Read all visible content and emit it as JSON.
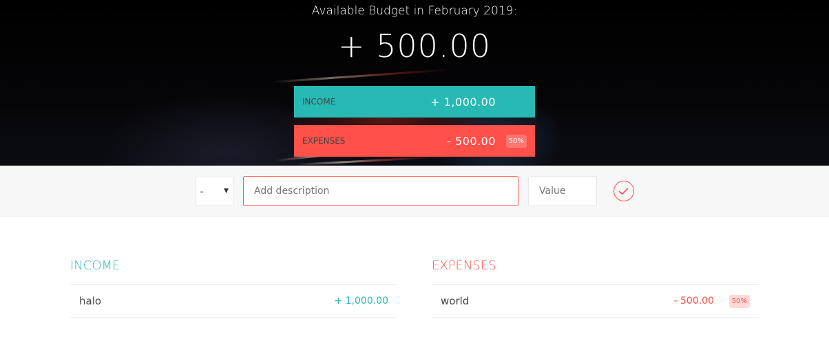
{
  "header": {
    "budget_title": "Available Budget in February 2019:",
    "budget_value": "+ 500.00",
    "income": {
      "label": "Income",
      "value": "+ 1,000.00"
    },
    "expenses": {
      "label": "Expenses",
      "value": "- 500.00",
      "percentage": "50%"
    }
  },
  "add_form": {
    "type_selected": "-",
    "description_placeholder": "Add description",
    "description_value": "",
    "value_placeholder": "Value",
    "value_value": "",
    "submit_icon": "checkmark-circle-icon"
  },
  "income_list": {
    "title": "Income",
    "items": [
      {
        "description": "halo",
        "value": "+ 1,000.00"
      }
    ]
  },
  "expenses_list": {
    "title": "Expenses",
    "items": [
      {
        "description": "world",
        "value": "- 500.00",
        "percentage": "50%"
      }
    ]
  },
  "colors": {
    "income_accent": "#28b9b5",
    "expenses_accent": "#ff5049",
    "add_bar_bg": "#f7f7f7"
  }
}
